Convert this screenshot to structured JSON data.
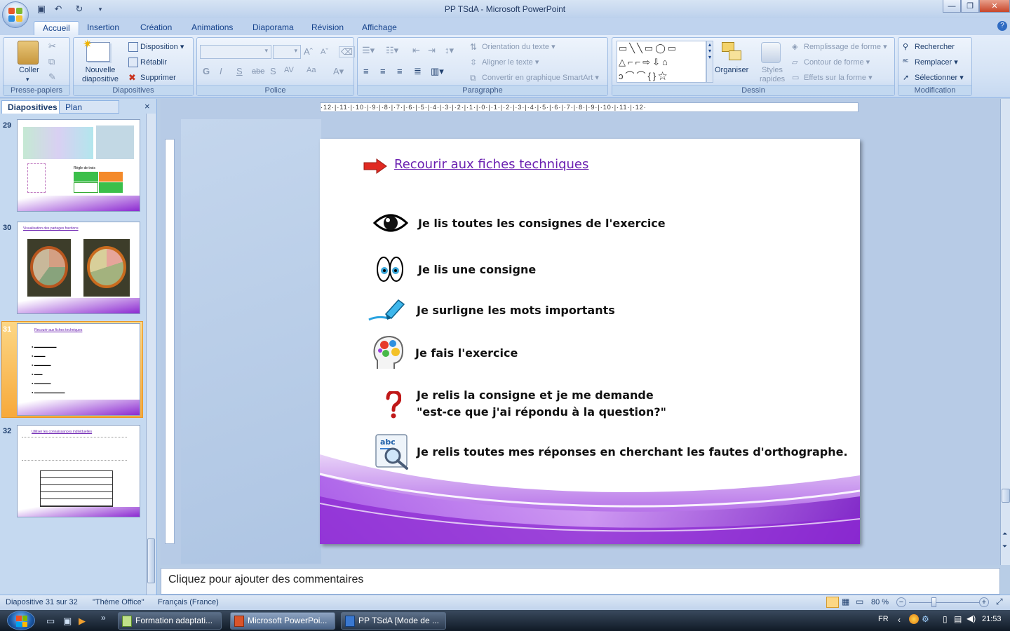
{
  "window": {
    "title": "PP TSdA - Microsoft PowerPoint"
  },
  "ribbon": {
    "tabs": [
      {
        "label": "Accueil"
      },
      {
        "label": "Insertion"
      },
      {
        "label": "Création"
      },
      {
        "label": "Animations"
      },
      {
        "label": "Diaporama"
      },
      {
        "label": "Révision"
      },
      {
        "label": "Affichage"
      }
    ],
    "clipboard": {
      "label": "Presse-papiers",
      "paste": "Coller"
    },
    "slides": {
      "label": "Diapositives",
      "new_slide": "Nouvelle\ndiapositive",
      "layout": "Disposition",
      "reset": "Rétablir",
      "delete": "Supprimer"
    },
    "font": {
      "label": "Police",
      "bold": "G",
      "italic": "I",
      "underline": "S",
      "strike": "abe",
      "shadow": "S",
      "spacing": "AV",
      "case": "Aa"
    },
    "paragraph": {
      "label": "Paragraphe",
      "text_direction": "Orientation du texte",
      "align_text": "Aligner le texte",
      "smartart": "Convertir en graphique SmartArt"
    },
    "drawing": {
      "label": "Dessin",
      "arrange": "Organiser",
      "quick_styles": "Styles\nrapides",
      "shape_fill": "Remplissage de forme",
      "shape_outline": "Contour de forme",
      "shape_effects": "Effets sur la forme"
    },
    "editing": {
      "label": "Modification",
      "find": "Rechercher",
      "replace": "Remplacer",
      "select": "Sélectionner"
    }
  },
  "panel": {
    "tabs": [
      {
        "label": "Diapositives"
      },
      {
        "label": "Plan"
      }
    ],
    "close": "×",
    "thumbnails": [
      {
        "number": "29",
        "caption": "Règle de trois"
      },
      {
        "number": "30",
        "caption": "Visualisation des partages fractions"
      },
      {
        "number": "31",
        "caption": "Recourir aux fiches techniques"
      },
      {
        "number": "32",
        "caption": "Utiliser les connaissances individuelles"
      }
    ]
  },
  "ruler": {
    "ticks": "·12·|·11·|·10·|·9·|·8·|·7·|·6·|·5·|·4·|·3·|·2·|·1·|·0·|·1·|·2·|·3·|·4·|·5·|·6·|·7·|·8·|·9·|·10·|·11·|·12·"
  },
  "slide": {
    "heading": "Recourir aux fiches techniques",
    "rows": [
      {
        "icon": "eye-icon",
        "text": "Je lis toutes les consignes de l'exercice"
      },
      {
        "icon": "cartoon-eyes-icon",
        "text": "Je lis une  consigne"
      },
      {
        "icon": "highlighter-icon",
        "text": "Je surligne les mots importants"
      },
      {
        "icon": "brain-gears-icon",
        "text": "Je fais l'exercice"
      },
      {
        "icon": "question-mark-icon",
        "text": "Je relis  la consigne et je me demande",
        "text2": "\"est-ce que j'ai répondu à la question?\""
      },
      {
        "icon": "spellcheck-magnifier-icon",
        "text": "Je relis toutes mes réponses en cherchant les fautes d'orthographe."
      }
    ],
    "accent_color": "#7a1fc4",
    "heading_color": "#6a1fb0"
  },
  "notes": {
    "placeholder": "Cliquez pour ajouter des commentaires"
  },
  "status": {
    "slide": "Diapositive 31 sur 32",
    "theme": "\"Thème Office\"",
    "language": "Français (France)",
    "zoom": "80 %"
  },
  "taskbar": {
    "items": [
      {
        "label": "Formation adaptati..."
      },
      {
        "label": "Microsoft PowerPoi..."
      },
      {
        "label": "PP TSdA [Mode de ..."
      }
    ],
    "lang": "FR",
    "clock": "21:53"
  }
}
